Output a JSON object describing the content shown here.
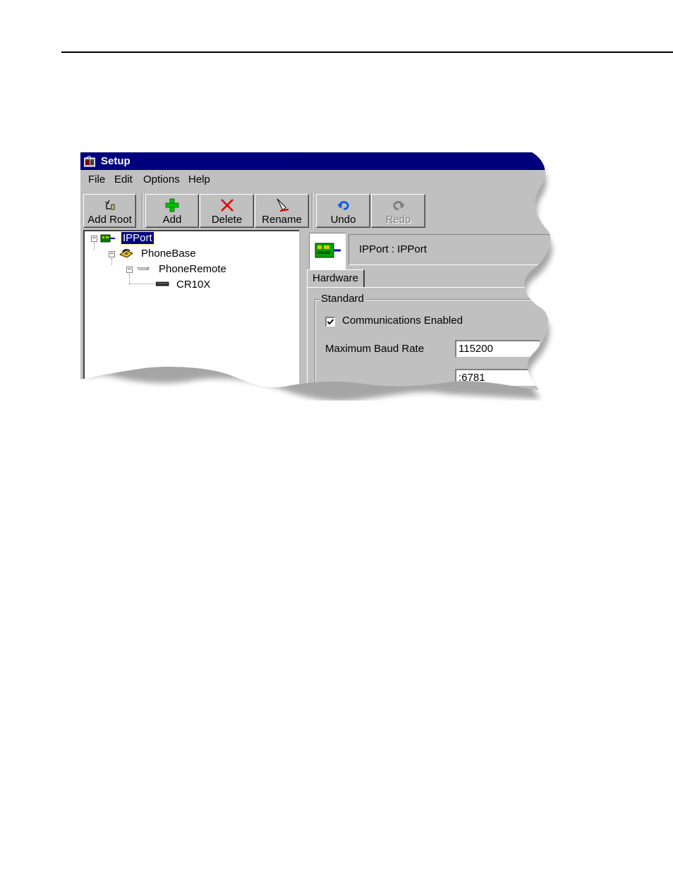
{
  "window": {
    "title": "Setup"
  },
  "menu": [
    "File",
    "Edit",
    "Options",
    "Help"
  ],
  "toolbar": {
    "add_root": "Add Root",
    "add": "Add",
    "delete": "Delete",
    "rename": "Rename",
    "undo": "Undo",
    "redo": "Redo"
  },
  "tree": {
    "root": "IPPort",
    "child": "PhoneBase",
    "grandchild": "PhoneRemote",
    "leaf": "CR10X"
  },
  "header": {
    "title": "IPPort : IPPort"
  },
  "tabs": {
    "hardware": "Hardware"
  },
  "standard": {
    "group_title": "Standard",
    "comm_enabled_label": "Communications Enabled",
    "comm_enabled_checked": true,
    "baud_label": "Maximum Baud Rate",
    "baud_value": "115200",
    "address_value": ":6781"
  },
  "colors": {
    "titlebar": "#000080",
    "selection": "#000080",
    "face": "#c0c0c0"
  }
}
